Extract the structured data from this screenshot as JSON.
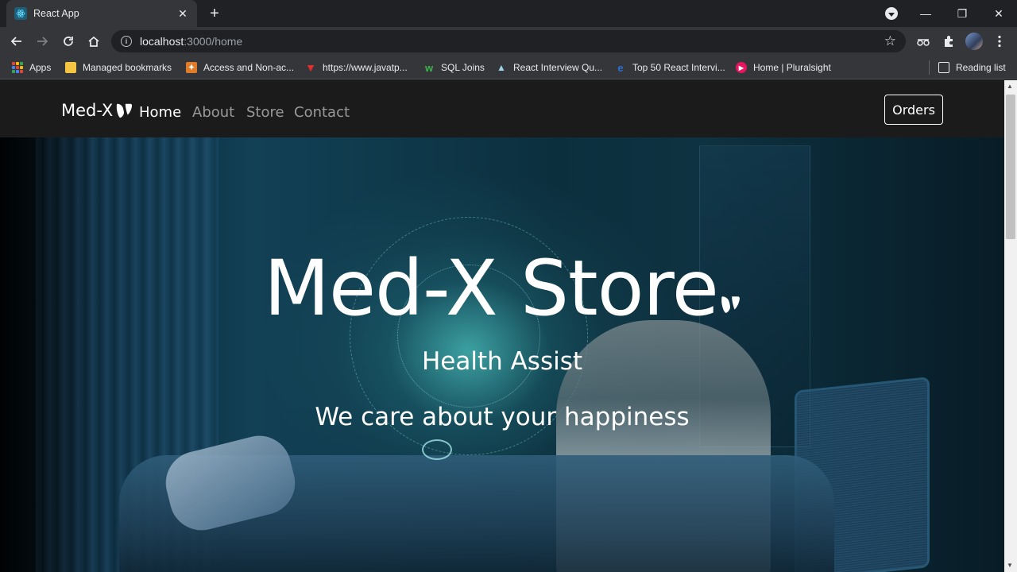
{
  "browser": {
    "tab_title": "React App",
    "tab_close": "✕",
    "new_tab": "+",
    "url_host": "localhost",
    "url_rest": ":3000/home",
    "window_controls": {
      "minimize": "—",
      "restore": "❐",
      "close": "✕"
    }
  },
  "bookmarks": [
    {
      "label": "Apps",
      "icon": "apps-grid-icon"
    },
    {
      "label": "Managed bookmarks",
      "icon": "folder-icon"
    },
    {
      "label": "Access and Non-ac...",
      "icon": "bookmark-icon"
    },
    {
      "label": "https://www.javatp...",
      "icon": "javatpoint-icon"
    },
    {
      "label": "SQL Joins",
      "icon": "w3-icon"
    },
    {
      "label": "React Interview Qu...",
      "icon": "mountain-icon"
    },
    {
      "label": "Top 50 React Intervi...",
      "icon": "edureka-icon"
    },
    {
      "label": "Home | Pluralsight",
      "icon": "pluralsight-icon"
    },
    {
      "label": "Reading list",
      "icon": "reading-list-icon"
    }
  ],
  "navbar": {
    "brand": "Med-X",
    "links": [
      "Home",
      "About",
      "Store",
      "Contact"
    ],
    "active": "Home",
    "orders_button": "Orders"
  },
  "hero": {
    "title": "Med-X Store",
    "subtitle": "Health Assist",
    "tagline": "We care about your happiness"
  },
  "colors": {
    "navbar_bg": "#1b1b1b",
    "chrome_bg": "#202124",
    "toolbar_bg": "#35363a"
  }
}
